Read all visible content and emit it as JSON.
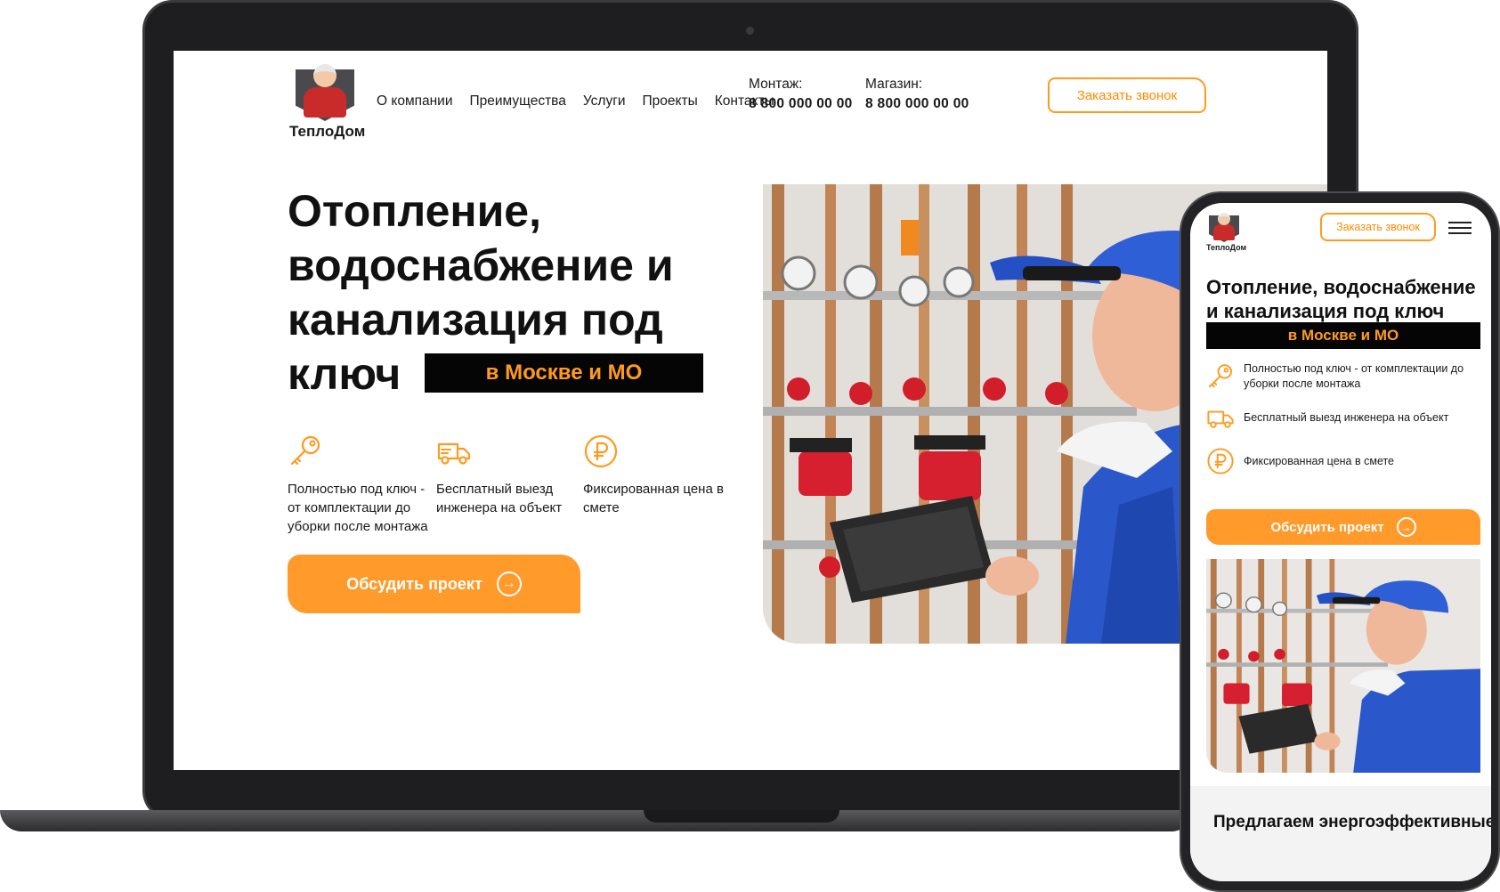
{
  "desktop": {
    "logo": {
      "text": "ТеплоДом"
    },
    "nav": [
      "О компании",
      "Преимущества",
      "Услуги",
      "Проекты",
      "Контакты"
    ],
    "phones": [
      {
        "label": "Монтаж:",
        "number": "8 800 000 00 00"
      },
      {
        "label": "Магазин:",
        "number": "8 800 000 00 00"
      }
    ],
    "callback_button": "Заказать звонок",
    "hero": {
      "title": "Отопление, водоснабжение и канализация под ключ",
      "region": "в Москве и МО"
    },
    "features": [
      {
        "icon": "key-icon",
        "text": "Полностью под ключ - от комплектации до уборки после монтажа"
      },
      {
        "icon": "truck-icon",
        "text": "Бесплатный выезд инженера на объект"
      },
      {
        "icon": "ruble-icon",
        "text": "Фиксированная цена в смете"
      }
    ],
    "cta_button": "Обсудить проект"
  },
  "mobile": {
    "logo": {
      "text": "ТеплоДом"
    },
    "callback_button": "Заказать звонок",
    "hero": {
      "title": "Отопление, водоснабжение и канализация под ключ",
      "region": "в Москве и МО"
    },
    "features": [
      {
        "icon": "key-icon",
        "text": "Полностью под ключ - от комплектации до уборки после монтажа"
      },
      {
        "icon": "truck-icon",
        "text": "Бесплатный выезд инженера на объект"
      },
      {
        "icon": "ruble-icon",
        "text": "Фиксированная цена в смете"
      }
    ],
    "cta_button": "Обсудить проект",
    "next_section_title": "Предлагаем энергоэффективные"
  },
  "colors": {
    "accent": "#ff9a2b",
    "accent_text": "#ff8a00",
    "dark": "#050505",
    "text": "#111111"
  }
}
